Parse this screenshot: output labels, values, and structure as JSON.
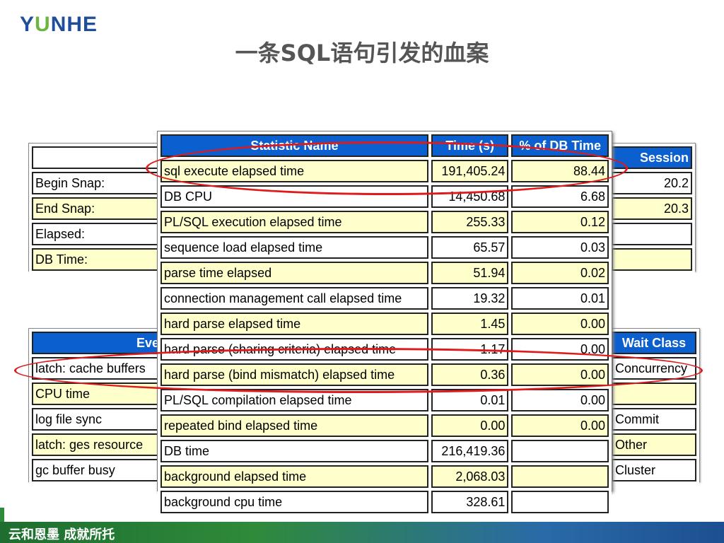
{
  "logo": {
    "part1": "Y",
    "part2": "U",
    "part3": "NHE"
  },
  "slide_title": "一条SQL语句引发的血案",
  "footer_text": "云和恩墨 成就所托",
  "snap_table": {
    "labels": [
      "Begin Snap:",
      "End Snap:",
      "Elapsed:",
      "DB Time:"
    ],
    "right_header": "Session",
    "right_values": [
      "20.2",
      "20.3",
      "",
      ""
    ]
  },
  "event_table": {
    "header": "Event",
    "rows": [
      "latch: cache buffers",
      "CPU time",
      "log file sync",
      "latch: ges resource",
      "gc buffer busy"
    ],
    "right_header": "Wait Class",
    "right_rows": [
      "Concurrency",
      "",
      "Commit",
      "Other",
      "Cluster"
    ]
  },
  "time_model": {
    "headers": {
      "name": "Statistic Name",
      "time": "Time (s)",
      "pct": "% of DB Time"
    },
    "rows": [
      {
        "name": "sql execute elapsed time",
        "time": "191,405.24",
        "pct": "88.44"
      },
      {
        "name": "DB CPU",
        "time": "14,450.68",
        "pct": "6.68"
      },
      {
        "name": "PL/SQL execution elapsed time",
        "time": "255.33",
        "pct": "0.12"
      },
      {
        "name": "sequence load elapsed time",
        "time": "65.57",
        "pct": "0.03"
      },
      {
        "name": "parse time elapsed",
        "time": "51.94",
        "pct": "0.02"
      },
      {
        "name": "connection management call elapsed time",
        "time": "19.32",
        "pct": "0.01"
      },
      {
        "name": "hard parse elapsed time",
        "time": "1.45",
        "pct": "0.00"
      },
      {
        "name": "hard parse (sharing criteria) elapsed time",
        "time": "1.17",
        "pct": "0.00"
      },
      {
        "name": "hard parse (bind mismatch) elapsed time",
        "time": "0.36",
        "pct": "0.00"
      },
      {
        "name": "PL/SQL compilation elapsed time",
        "time": "0.01",
        "pct": "0.00"
      },
      {
        "name": "repeated bind elapsed time",
        "time": "0.00",
        "pct": "0.00"
      },
      {
        "name": "DB time",
        "time": "216,419.36",
        "pct": ""
      },
      {
        "name": "background elapsed time",
        "time": "2,068.03",
        "pct": ""
      },
      {
        "name": "background cpu time",
        "time": "328.61",
        "pct": ""
      }
    ]
  },
  "colors": {
    "header_blue": "#0b5fcf",
    "row_yellow": "#ffffcc",
    "highlight_red": "#e01a1a"
  }
}
